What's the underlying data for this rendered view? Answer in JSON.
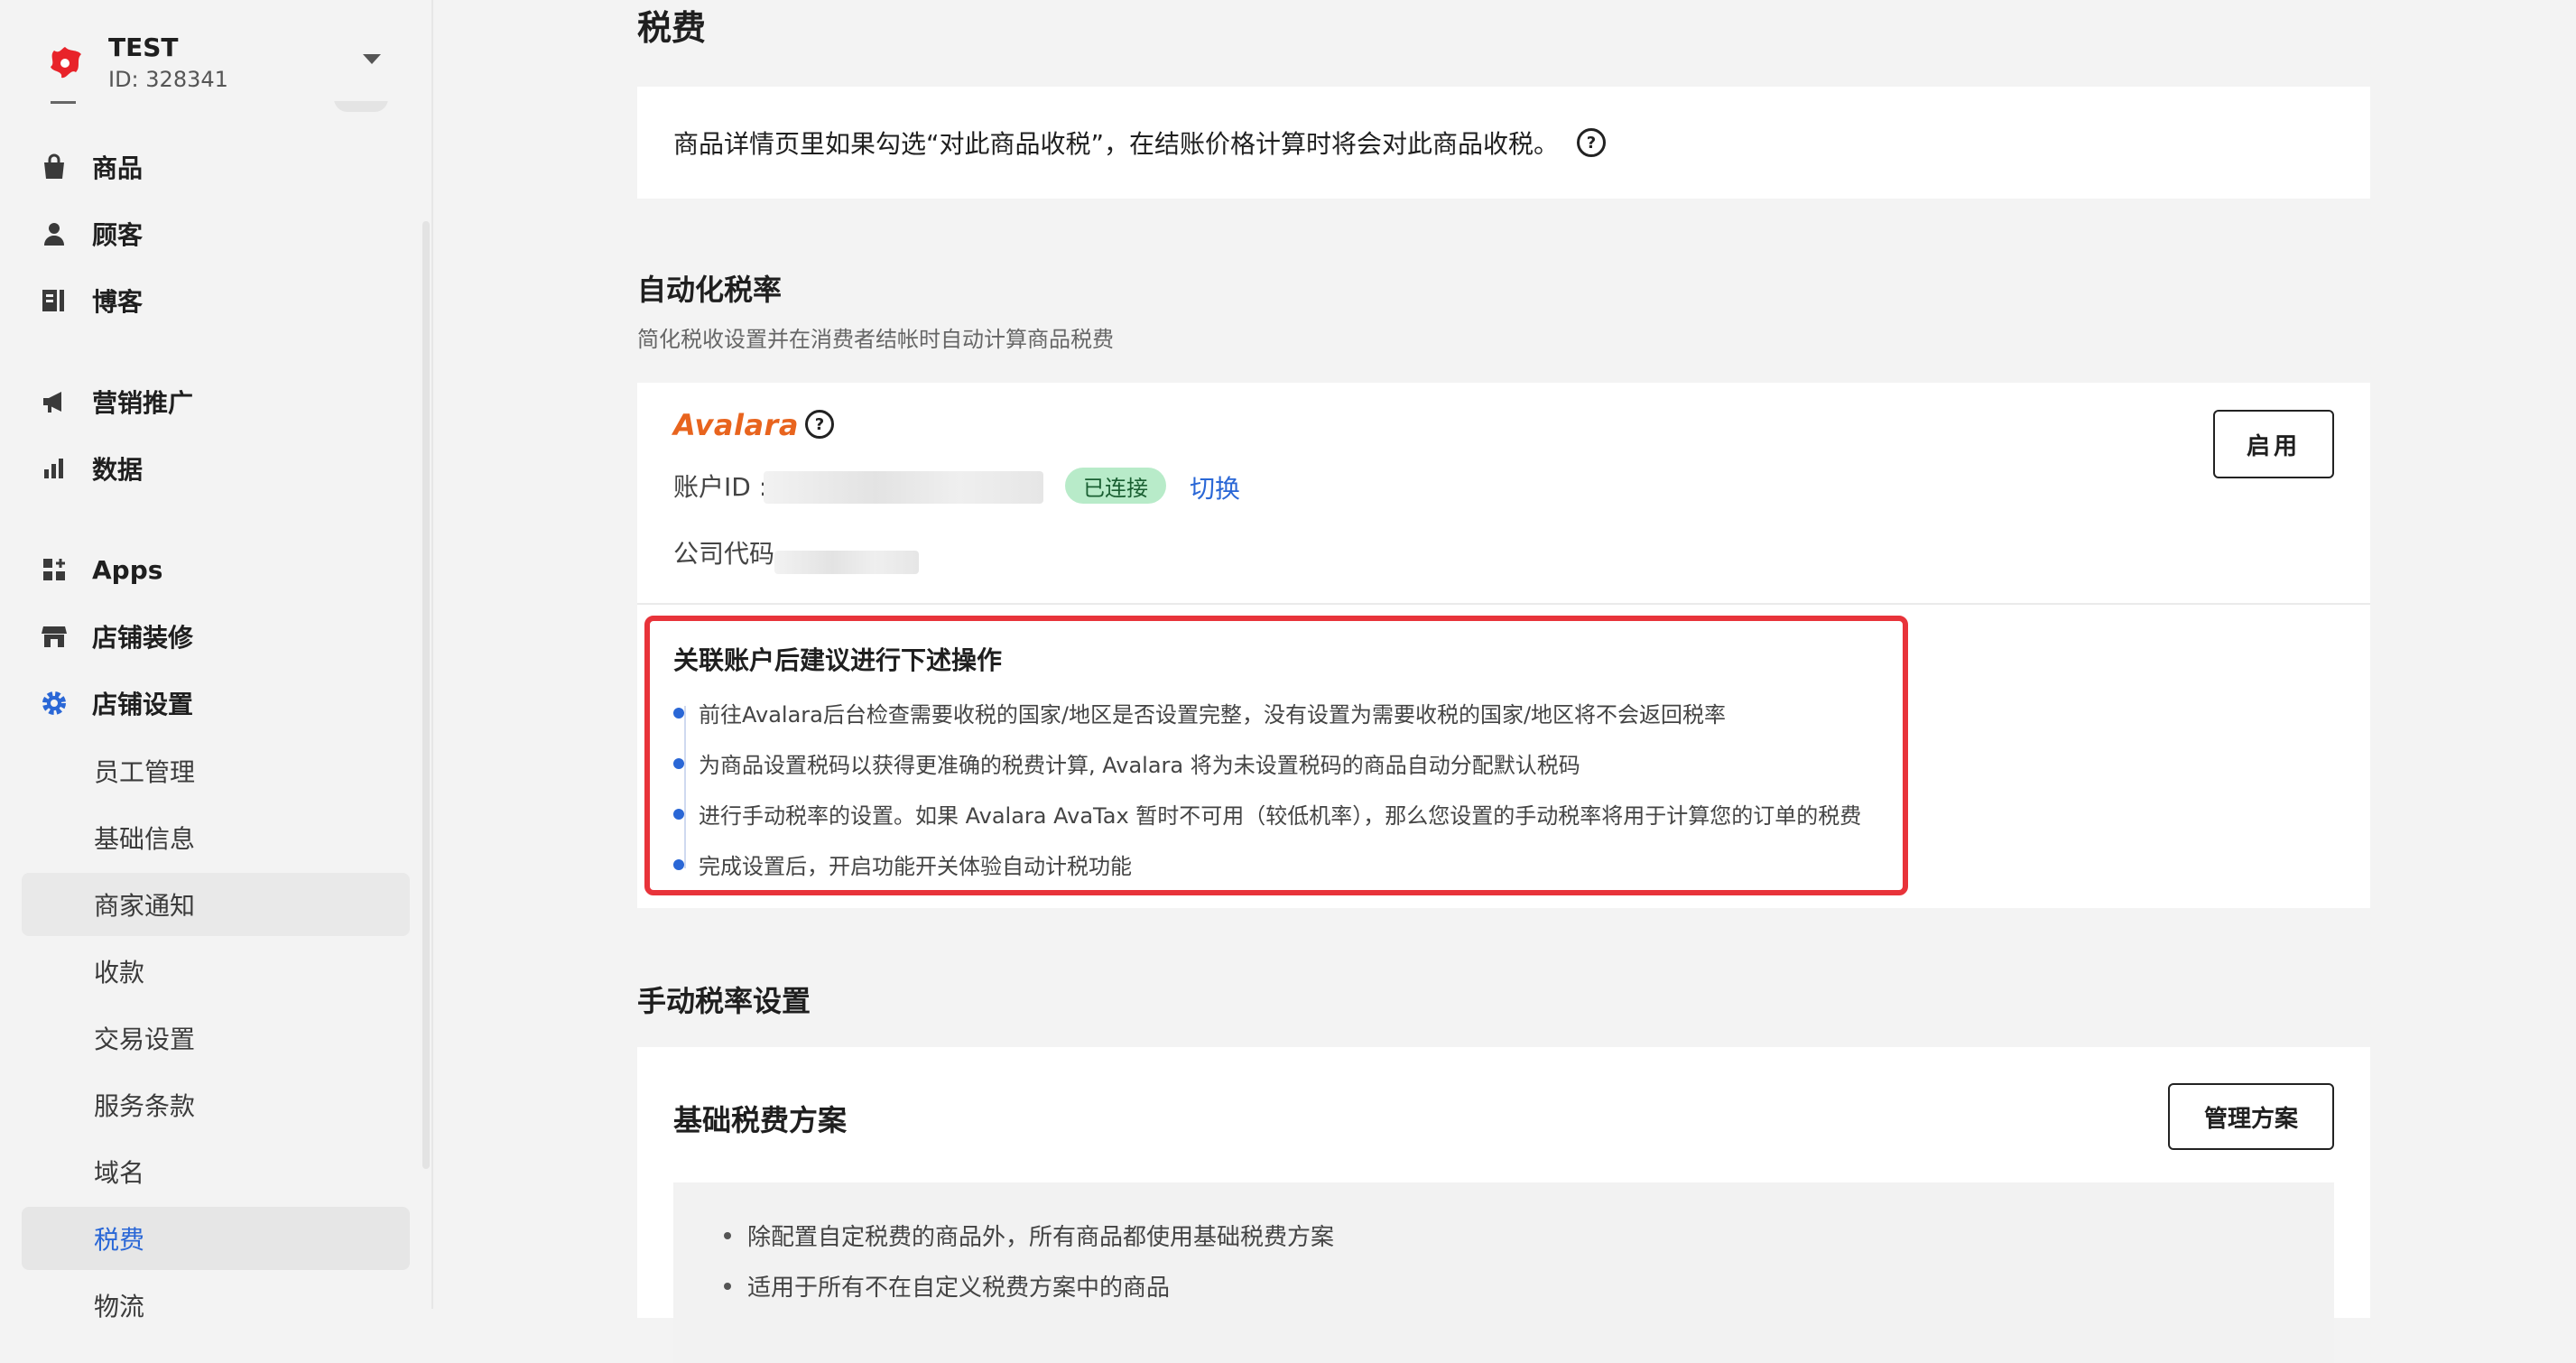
{
  "store": {
    "name": "TEST",
    "id_label": "ID: 328341"
  },
  "nav": {
    "items": [
      {
        "label": "商品",
        "icon": "bag-icon"
      },
      {
        "label": "顾客",
        "icon": "person-icon"
      },
      {
        "label": "博客",
        "icon": "blog-icon"
      },
      {
        "label": "营销推广",
        "icon": "megaphone-icon"
      },
      {
        "label": "数据",
        "icon": "chart-icon"
      },
      {
        "label": "Apps",
        "icon": "apps-icon"
      },
      {
        "label": "店铺装修",
        "icon": "store-icon"
      },
      {
        "label": "店铺设置",
        "icon": "gear-icon"
      }
    ],
    "sub_items": [
      "员工管理",
      "基础信息",
      "商家通知",
      "收款",
      "交易设置",
      "服务条款",
      "域名",
      "税费",
      "物流"
    ],
    "active_sub": "税费",
    "accent_color": "#2a67d6"
  },
  "page": {
    "title": "税费",
    "note": "商品详情页里如果勾选“对此商品收税”，在结账价格计算时将会对此商品收税。",
    "help_glyph": "?"
  },
  "auto_tax": {
    "title": "自动化税率",
    "subtitle": "简化税收设置并在消费者结帐时自动计算商品税费",
    "provider": "Avalara",
    "account_label": "账户ID :",
    "status_badge": "已连接",
    "switch_label": "切换",
    "company_label": "公司代码",
    "enable_button": "启用"
  },
  "recommendations": {
    "title": "关联账户后建议进行下述操作",
    "items": [
      "前往Avalara后台检查需要收税的国家/地区是否设置完整，没有设置为需要收税的国家/地区将不会返回税率",
      "为商品设置税码以获得更准确的税费计算, Avalara 将为未设置税码的商品自动分配默认税码",
      "进行手动税率的设置。如果 Avalara AvaTax 暂时不可用（较低机率），那么您设置的手动税率将用于计算您的订单的税费",
      "完成设置后，开启功能开关体验自动计税功能"
    ],
    "highlight_color": "#e8333a"
  },
  "manual_tax": {
    "title": "手动税率设置",
    "base_plan_title": "基础税费方案",
    "manage_button": "管理方案",
    "info_items": [
      "除配置自定税费的商品外，所有商品都使用基础税费方案",
      "适用于所有不在自定义税费方案中的商品"
    ]
  }
}
